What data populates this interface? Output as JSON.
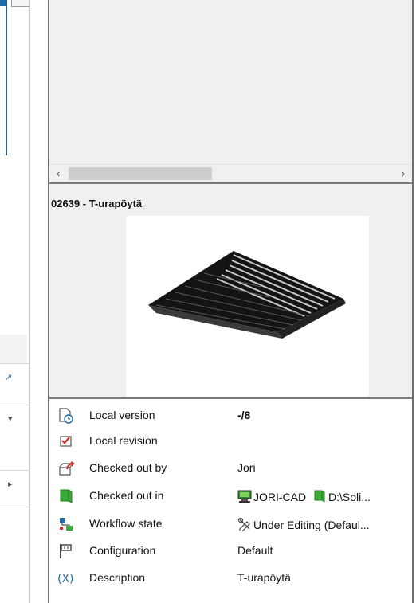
{
  "preview": {
    "file_title": "02639 - T-urapöytä"
  },
  "scrollbar": {
    "left_arrow": "‹",
    "right_arrow": "›"
  },
  "properties": [
    {
      "icon": "local-version-icon",
      "label": "Local version",
      "value": "-/8"
    },
    {
      "icon": "local-revision-icon",
      "label": "Local revision",
      "value": ""
    },
    {
      "icon": "checked-out-by-icon",
      "label": "Checked out by",
      "value": "Jori"
    },
    {
      "icon": "checked-out-in-icon",
      "label": "Checked out in",
      "value_computer": "JORI-CAD",
      "value_path": "D:\\Soli..."
    },
    {
      "icon": "workflow-state-icon",
      "label": "Workflow state",
      "value": "Under Editing (Defaul..."
    },
    {
      "icon": "configuration-icon",
      "label": "Configuration",
      "value": "Default"
    },
    {
      "icon": "description-icon",
      "label": "Description",
      "value": "T-urapöytä"
    }
  ],
  "colors": {
    "panel_bg": "#f0f0f0",
    "separator": "#7a7a7a",
    "accent_green": "#3aa935",
    "accent_red": "#d4302a",
    "accent_blue": "#1e6aa8"
  }
}
